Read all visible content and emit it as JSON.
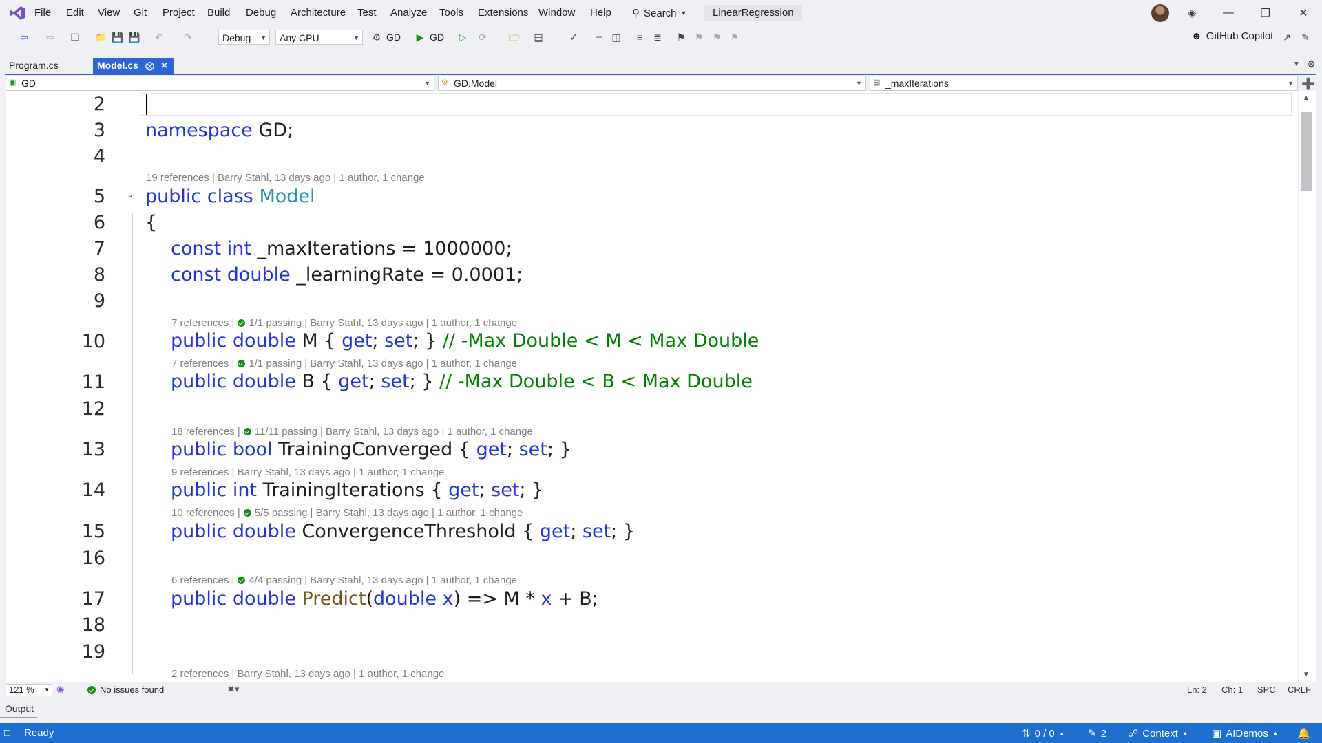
{
  "menu": {
    "items": [
      "File",
      "Edit",
      "View",
      "Git",
      "Project",
      "Build",
      "Debug",
      "Architecture",
      "Test",
      "Analyze",
      "Tools",
      "Extensions",
      "Window",
      "Help"
    ],
    "search_label": "Search",
    "solution_name": "LinearRegression"
  },
  "toolbar": {
    "config": "Debug",
    "platform": "Any CPU",
    "startup_project": "GD",
    "run_label": "GD",
    "copilot_label": "GitHub Copilot"
  },
  "tabs": [
    {
      "label": "Program.cs",
      "active": false
    },
    {
      "label": "Model.cs",
      "active": true
    }
  ],
  "navbar": {
    "project": "GD",
    "type": "GD.Model",
    "member": "_maxIterations"
  },
  "editor": {
    "line_numbers": [
      "2",
      "3",
      "4",
      "5",
      "6",
      "7",
      "8",
      "9",
      "10",
      "11",
      "12",
      "13",
      "14",
      "15",
      "16",
      "17",
      "18",
      "19"
    ],
    "codelens": {
      "class_model": "19 references | Barry Stahl, 13 days ago | 1 author, 1 change",
      "prop_m_refs": "7 references |",
      "prop_m_pass": "1/1 passing",
      "prop_m_rest": "| Barry Stahl, 13 days ago | 1 author, 1 change",
      "prop_b_refs": "7 references |",
      "prop_b_pass": "1/1 passing",
      "prop_b_rest": "| Barry Stahl, 13 days ago | 1 author, 1 change",
      "training_converged_refs": "18 references |",
      "training_converged_pass": "11/11 passing",
      "training_converged_rest": "| Barry Stahl, 13 days ago | 1 author, 1 change",
      "training_iterations": "9 references | Barry Stahl, 13 days ago | 1 author, 1 change",
      "convergence_refs": "10 references |",
      "convergence_pass": "5/5 passing",
      "convergence_rest": "| Barry Stahl, 13 days ago | 1 author, 1 change",
      "predict_refs": "6 references |",
      "predict_pass": "4/4 passing",
      "predict_rest": "| Barry Stahl, 13 days ago | 1 author, 1 change",
      "next_member": "2 references | Barry Stahl, 13 days ago | 1 author, 1 change"
    },
    "code": {
      "l3_kw": "namespace",
      "l3_rest": " GD;",
      "l5_kw": "public class",
      "l5_type": "Model",
      "l6": "{",
      "l7_kw": "const int",
      "l7_rest": " _maxIterations = 1000000;",
      "l8_kw": "const double",
      "l8_rest": " _learningRate = 0.0001;",
      "l10_kw": "public double",
      "l10_name": " M { ",
      "l10_get": "get",
      "l10_mid": "; ",
      "l10_set": "set",
      "l10_end": "; } ",
      "l10_comment": "// -Max Double < M < Max Double",
      "l11_kw": "public double",
      "l11_name": " B { ",
      "l11_get": "get",
      "l11_mid": "; ",
      "l11_set": "set",
      "l11_end": "; } ",
      "l11_comment": "// -Max Double < B < Max Double",
      "l13_kw": "public bool",
      "l13_name": " TrainingConverged { ",
      "l13_get": "get",
      "l13_mid": "; ",
      "l13_set": "set",
      "l13_end": "; }",
      "l14_kw": "public int",
      "l14_name": " TrainingIterations { ",
      "l14_get": "get",
      "l14_mid": "; ",
      "l14_set": "set",
      "l14_end": "; }",
      "l15_kw": "public double",
      "l15_name": " ConvergenceThreshold { ",
      "l15_get": "get",
      "l15_mid": "; ",
      "l15_set": "set",
      "l15_end": "; }",
      "l17_kw": "public double",
      "l17_sp": " ",
      "l17_method": "Predict",
      "l17_open": "(",
      "l17_ptype": "double",
      "l17_sp2": " ",
      "l17_param": "x",
      "l17_mid": ") => M * ",
      "l17_x": "x",
      "l17_end": " + B;"
    }
  },
  "editor_status": {
    "zoom": "121 %",
    "issues": "No issues found",
    "ln": "Ln: 2",
    "ch": "Ch: 1",
    "spc": "SPC",
    "crlf": "CRLF"
  },
  "output_tab": "Output",
  "statusbar": {
    "ready": "Ready",
    "git_changes": "0 / 0",
    "pencil_count": "2",
    "context": "Context",
    "repo": "AIDemos"
  },
  "colors": {
    "accent": "#2f64d6",
    "statusbar": "#1f6fd1",
    "keyword": "#1f37d6",
    "type": "#2b91af",
    "comment": "#008000",
    "pass": "#1a8a1a"
  }
}
